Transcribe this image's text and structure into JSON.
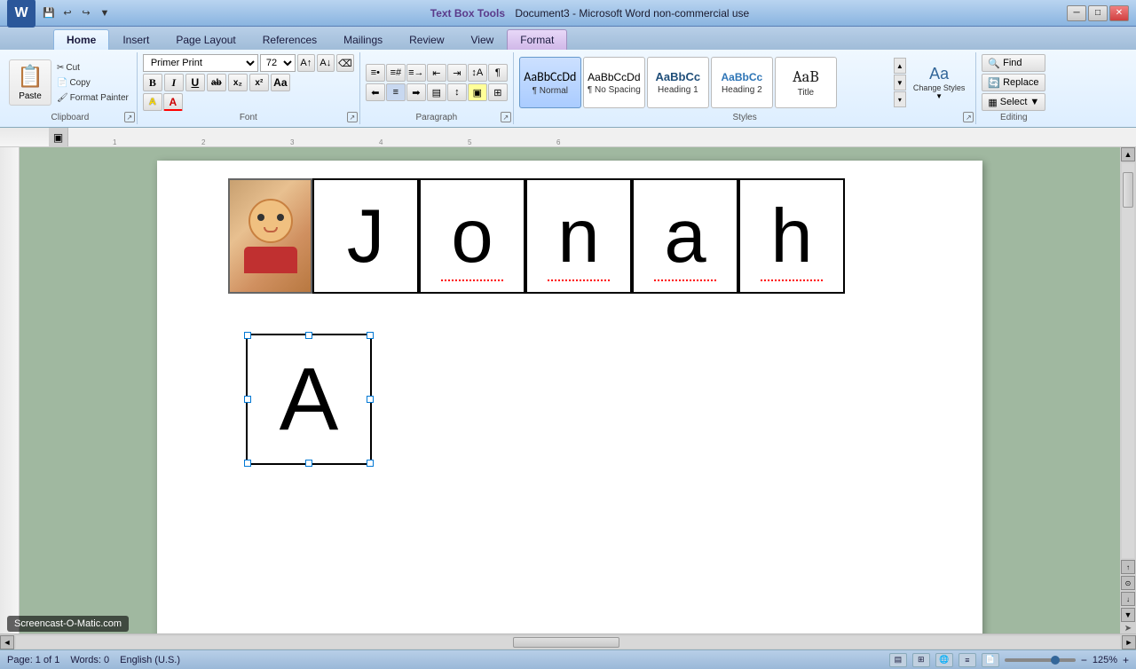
{
  "titlebar": {
    "title": "Document3 - Microsoft Word non-commercial use",
    "subtitle": "Text Box Tools",
    "minimize": "─",
    "maximize": "□",
    "close": "✕"
  },
  "quickaccess": {
    "save": "💾",
    "undo": "↩",
    "redo": "↪"
  },
  "tabs": [
    {
      "label": "Home",
      "active": true
    },
    {
      "label": "Insert",
      "active": false
    },
    {
      "label": "Page Layout",
      "active": false
    },
    {
      "label": "References",
      "active": false
    },
    {
      "label": "Mailings",
      "active": false
    },
    {
      "label": "Review",
      "active": false
    },
    {
      "label": "View",
      "active": false
    },
    {
      "label": "Format",
      "active": false,
      "special": true
    }
  ],
  "clipboard": {
    "paste_label": "Paste",
    "cut_label": "Cut",
    "copy_label": "Copy",
    "format_painter_label": "Format Painter",
    "group_label": "Clipboard"
  },
  "font": {
    "name": "Primer Print",
    "size": "72",
    "bold": "B",
    "italic": "I",
    "underline": "U",
    "strikethrough": "ab",
    "subscript": "x₂",
    "superscript": "x²",
    "change_case": "Aa",
    "highlight": "A",
    "color": "A",
    "group_label": "Font"
  },
  "paragraph": {
    "group_label": "Paragraph"
  },
  "styles": {
    "group_label": "Styles",
    "items": [
      {
        "label": "Normal",
        "preview": "AaBbCcDd",
        "active": true
      },
      {
        "label": "No Spacing",
        "preview": "AaBbCcDd",
        "active": false
      },
      {
        "label": "Heading 1",
        "preview": "AaBbCc",
        "active": false
      },
      {
        "label": "Heading 2",
        "preview": "AaBbCc",
        "active": false
      },
      {
        "label": "Title",
        "preview": "AaB",
        "active": false
      }
    ],
    "change_styles_label": "Change Styles",
    "change_styles_arrow": "▼"
  },
  "editing": {
    "group_label": "Editing",
    "find_label": "Find",
    "replace_label": "Replace",
    "select_label": "Select"
  },
  "document": {
    "name_letters": [
      "J",
      "o",
      "n",
      "a",
      "h"
    ],
    "selected_letter": "A",
    "zoom": "125%"
  },
  "statusbar": {
    "page_info": "Page: 1 of 1",
    "words": "Words: 0",
    "language": "English (U.S.)",
    "zoom_level": "125%"
  },
  "watermark": "Screencast-O-Matic.com"
}
